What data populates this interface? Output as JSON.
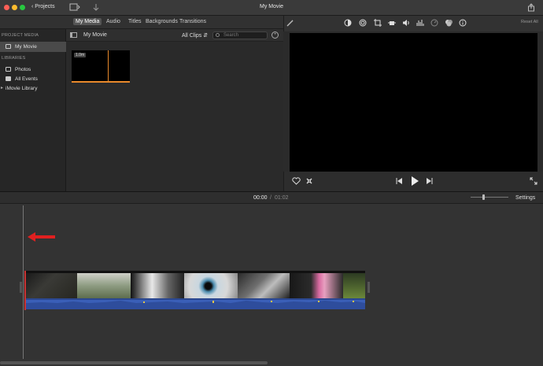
{
  "window": {
    "title": "My Movie",
    "projects_label": "Projects"
  },
  "media_tabs": [
    {
      "label": "My Media",
      "active": true
    },
    {
      "label": "Audio",
      "active": false
    },
    {
      "label": "Titles",
      "active": false
    },
    {
      "label": "Backgrounds",
      "active": false
    },
    {
      "label": "Transitions",
      "active": false
    }
  ],
  "sidebar": {
    "project_media_heading": "PROJECT MEDIA",
    "project_item": "My Movie",
    "libraries_heading": "LIBRARIES",
    "library_items": [
      "Photos",
      "All Events",
      "iMovie Library"
    ]
  },
  "browser": {
    "title": "My Movie",
    "filter": "All Clips",
    "search_placeholder": "Search",
    "clip_duration": "1.0m"
  },
  "viewer": {
    "reset_all": "Reset All"
  },
  "timeline": {
    "current_time": "00:00",
    "separator": "/",
    "total_time": "01:02",
    "settings_label": "Settings"
  },
  "colors": {
    "accent_orange": "#e8892b",
    "arrow_red": "#e02020",
    "audio_blue": "#3a5fb8",
    "traffic_red": "#ff5f57",
    "traffic_yellow": "#febc2e",
    "traffic_green": "#28c840"
  },
  "icons": [
    "back-chevron-icon",
    "media-browser-icon",
    "import-icon",
    "share-icon",
    "magic-wand-icon",
    "color-balance-icon",
    "color-correction-icon",
    "crop-icon",
    "stabilization-icon",
    "volume-icon",
    "equalizer-icon",
    "speed-icon",
    "filter-icon",
    "info-icon",
    "favorite-icon",
    "reject-icon",
    "skip-back-icon",
    "play-icon",
    "skip-forward-icon",
    "fullscreen-icon"
  ]
}
